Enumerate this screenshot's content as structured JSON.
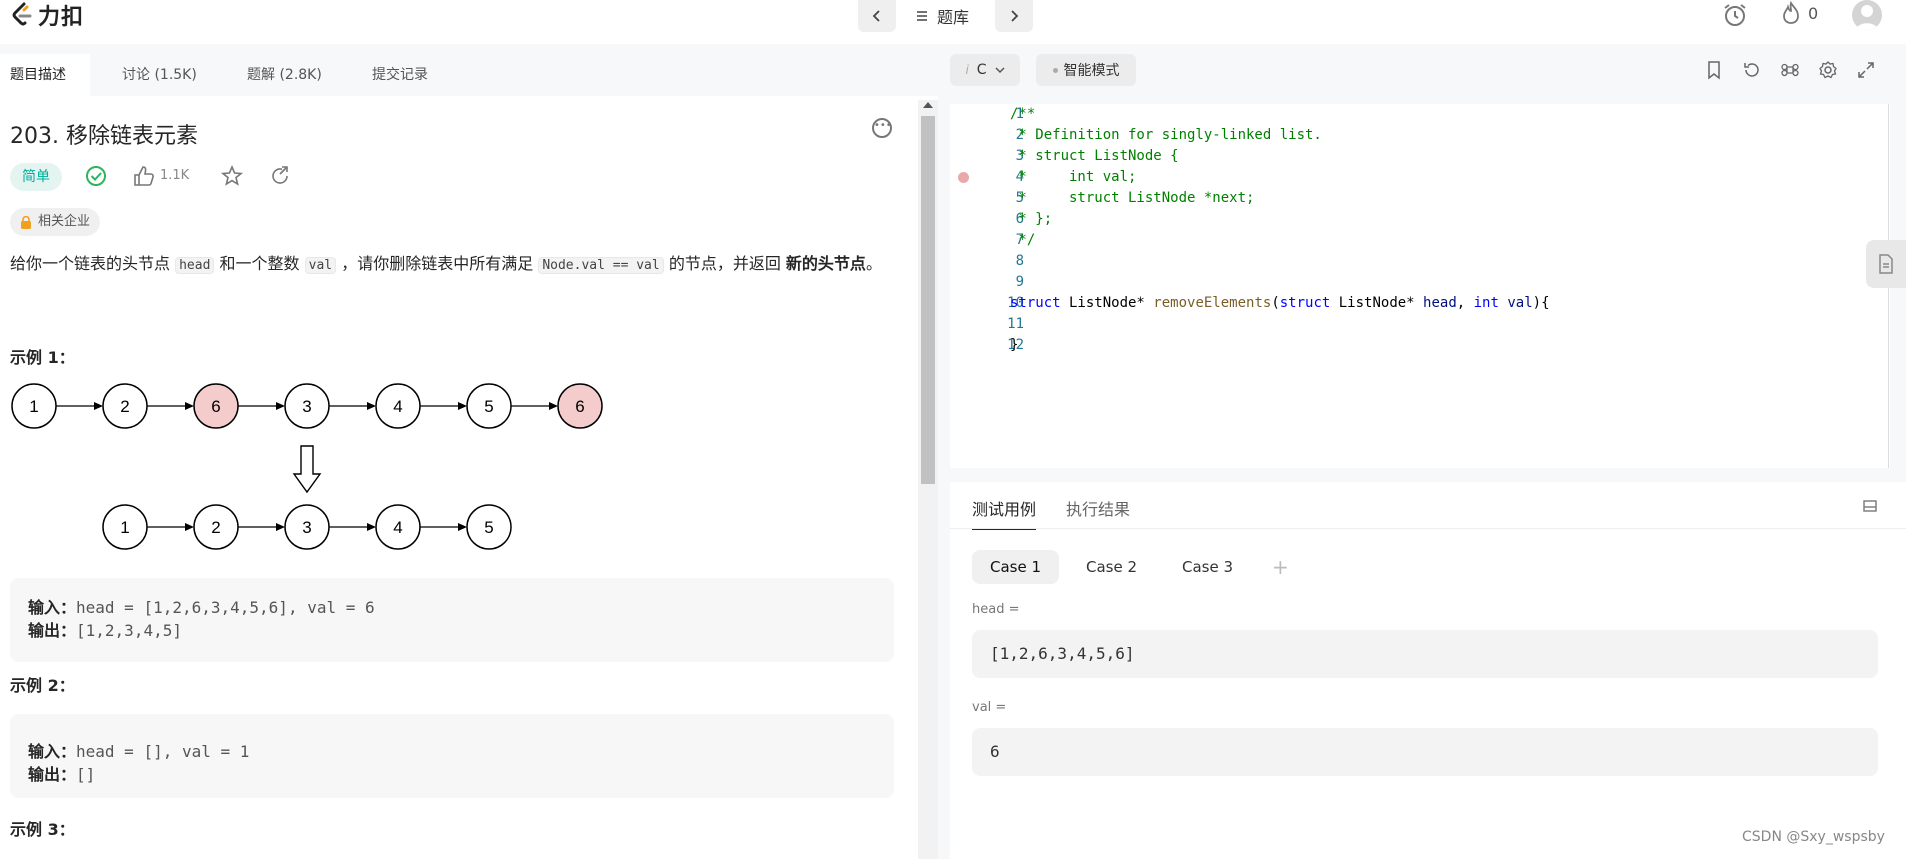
{
  "header": {
    "logo_text": "力扣",
    "nav_label": "题库",
    "streak": "0",
    "icons": [
      "alarm-icon",
      "fire-icon",
      "avatar-icon",
      "chevron-left-icon",
      "chevron-right-icon",
      "list-icon"
    ]
  },
  "left_tabs": [
    "题目描述",
    "讨论 (1.5K)",
    "题解 (2.8K)",
    "提交记录"
  ],
  "problem": {
    "title": "203. 移除链表元素",
    "difficulty": "简单",
    "likes": "1.1K",
    "company_label": "相关企业",
    "desc_1": "给你一个链表的头节点",
    "code_head": "head",
    "desc_2": "和一个整数",
    "code_val": "val",
    "desc_3": "，请你删除链表中所有满足",
    "code_cond": "Node.val == val",
    "desc_4": "的节点，并返回",
    "desc_bold": "新的头节点",
    "desc_end": "。"
  },
  "diagram": {
    "before": [
      "1",
      "2",
      "6",
      "3",
      "4",
      "5",
      "6"
    ],
    "after": [
      "1",
      "2",
      "3",
      "4",
      "5"
    ],
    "highlight_value": "6",
    "highlight_color": "#f4cccc"
  },
  "examples": [
    {
      "label": "示例 1：",
      "input_label": "输入：",
      "input": "head = [1,2,6,3,4,5,6], val = 6",
      "output_label": "输出：",
      "output": "[1,2,3,4,5]"
    },
    {
      "label": "示例 2：",
      "input_label": "输入：",
      "input": "head = [], val = 1",
      "output_label": "输出：",
      "output": "[]"
    },
    {
      "label": "示例 3："
    }
  ],
  "editor": {
    "language": "C",
    "smart_mode": "智能模式",
    "lines": [
      {
        "n": "1"
      },
      {
        "n": "2"
      },
      {
        "n": "3"
      },
      {
        "n": "4"
      },
      {
        "n": "5"
      },
      {
        "n": "6"
      },
      {
        "n": "7"
      },
      {
        "n": "8"
      },
      {
        "n": "9"
      },
      {
        "n": "10"
      },
      {
        "n": "11"
      },
      {
        "n": "12"
      }
    ],
    "code": {
      "l1": "/**",
      "l2": " * Definition for singly-linked list.",
      "l3": " * struct ListNode {",
      "l4": " *     int val;",
      "l5": " *     struct ListNode *next;",
      "l6": " * };",
      "l7": " */",
      "l10_kw1": "struct",
      "l10_t1": " ListNode* ",
      "l10_fn": "removeElements",
      "l10_t2": "(",
      "l10_kw2": "struct",
      "l10_t3": " ListNode* ",
      "l10_v1": "head",
      "l10_t4": ", ",
      "l10_kw3": "int",
      "l10_t5": " ",
      "l10_v2": "val",
      "l10_t6": "){",
      "l12": "}"
    }
  },
  "test_panel": {
    "tabs": [
      "测试用例",
      "执行结果"
    ],
    "cases": [
      "Case 1",
      "Case 2",
      "Case 3"
    ],
    "add_label": "+",
    "head_label": "head =",
    "head_value": "[1,2,6,3,4,5,6]",
    "val_label": "val =",
    "val_value": "6"
  },
  "watermark": "CSDN @Sxy_wspsby"
}
